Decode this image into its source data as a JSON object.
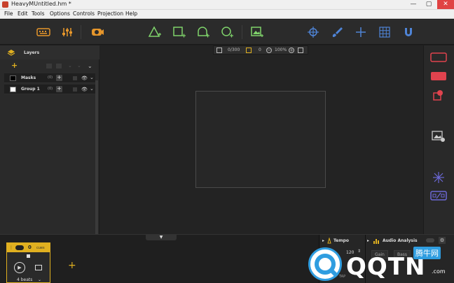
{
  "window": {
    "title": "HeavyMUntitled.hm *",
    "minimize": "—",
    "maximize": "▢",
    "close": "✕"
  },
  "menu": [
    "File",
    "Edit",
    "Tools",
    "Options",
    "Controls",
    "Projection",
    "Help"
  ],
  "toolbar_icons": [
    "keyboard-icon",
    "mixer-sliders-icon",
    "webcam-icon",
    "add-triangle-icon",
    "add-square-icon",
    "add-circle-icon",
    "add-polygon-icon",
    "add-image-icon",
    "target-icon",
    "brush-icon",
    "crosshair-icon",
    "grid-icon",
    "magnet-icon"
  ],
  "accent_green": "#7fd36b",
  "accent_blue": "#4f84d6",
  "accent_orange": "#e6962b",
  "accent_red": "#e0434e",
  "accent_yellow": "#e0b020",
  "layers": {
    "title": "Layers",
    "rows": [
      {
        "name": "Masks",
        "count": "(0)",
        "swatch": "#000000"
      },
      {
        "name": "Group 1",
        "count": "(0)",
        "swatch": "#ffffff"
      }
    ]
  },
  "canvas_bar": {
    "counter": "0/300",
    "value": "0",
    "zoom": "100%"
  },
  "cue": {
    "count": "0",
    "label": "cues",
    "beats": "4 beats"
  },
  "tempo": {
    "title": "Tempo",
    "bpm": "120",
    "tap": "TAP"
  },
  "audio": {
    "title": "Audio Analysis",
    "gain": "Gain",
    "bass": "Bass"
  },
  "watermark": {
    "brand": "QQTN",
    "tag": "腾牛网",
    "site": ".com"
  }
}
